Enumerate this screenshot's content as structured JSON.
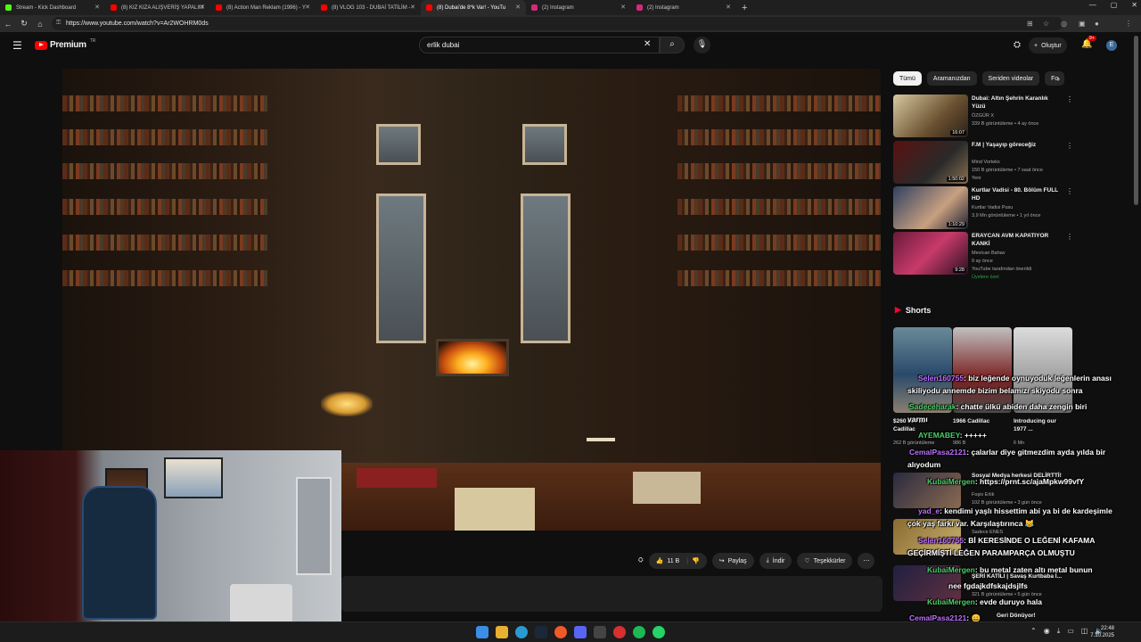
{
  "browser": {
    "tabs": [
      {
        "label": "Stream - Kick Dashboard",
        "color": "#53fc18"
      },
      {
        "label": "(8) KIZ KIZA ALIŞVERİŞ YAPALIM",
        "color": "#ff0000"
      },
      {
        "label": "(8) Action Man Reklam (1996) - Y",
        "color": "#ff0000"
      },
      {
        "label": "(8) VLOG 103 - DUBAİ TATİLİM -",
        "color": "#ff0000"
      },
      {
        "label": "(8) Dubai'de 8*k Var! - YouTu",
        "color": "#ff0000"
      },
      {
        "label": "(2) Instagram",
        "color": "#d62976"
      },
      {
        "label": "(2) Instagram",
        "color": "#d62976"
      }
    ],
    "url": "https://www.youtube.com/watch?v=Ar2WOHRM0ds"
  },
  "header": {
    "logo": "Premium",
    "logo_region": "TR",
    "search_value": "erlik dubai",
    "create_label": "Oluştur",
    "notif_count": "9+",
    "avatar_letter": "E"
  },
  "actions": {
    "like_count": "11 B",
    "share": "Paylaş",
    "download": "İndir",
    "thanks": "Teşekkürler"
  },
  "chips": [
    "Tümü",
    "Aramanızdan",
    "Seriden videolar",
    "Fo"
  ],
  "recommendations": [
    {
      "title": "Dubai: Altın Şehrin Karanlık Yüzü",
      "channel": "ÖZGÜR X",
      "meta": "339 B görüntüleme • 4 ay önce",
      "duration": "16:07",
      "badge": ""
    },
    {
      "title": "F.M | Yaşayıp göreceğiz",
      "channel": "Mind Vortekx",
      "meta": "150 B görüntüleme • 7 saat önce",
      "duration": "1:50:02",
      "badge": "Yeni"
    },
    {
      "title": "Kurtlar Vadisi - 80. Bölüm FULL HD",
      "channel": "Kurtlar Vadisi Pusu",
      "meta": "3,9 Mn görüntüleme • 1 yıl önce",
      "duration": "1:10:29",
      "badge": ""
    },
    {
      "title": "ERAYCAN AVM KAPATIYOR KANKİ",
      "channel": "Mevican Bahav",
      "meta": "9 ay önce",
      "duration": "9:28",
      "badge": "YouTube tarafından önerildi",
      "member": "Üyelere özel"
    }
  ],
  "shorts": {
    "header": "Shorts",
    "items": [
      {
        "title": "$260 000'lık Cadillac",
        "meta": "262 B görüntüleme"
      },
      {
        "title": "1966 Cadillac",
        "meta": "986 B"
      },
      {
        "title": "Introducing our 1977 ...",
        "meta": "6 Mn"
      }
    ]
  },
  "sidebar_fragments": [
    "Sosyal Medya herkesi DELİRTTİ!",
    "Foşix Erlik",
    "102 B görüntüleme • 3 gün önce",
    "Sadece ENES",
    "ŞERİ KATİLİ | Savaş Kurtbaba İ...",
    "321 B görüntüleme • 5 gün önce",
    "Geri Dönüyor!"
  ],
  "chat": [
    {
      "user": "Selen160755",
      "msg": ": biz leğende oynuyoduk leğenlerin anası",
      "ucolor": "#c070ff"
    },
    {
      "user": "",
      "msg": "skiliyodu annemde bizim belamızı skiyodu sonra",
      "ucolor": ""
    },
    {
      "user": "Sadeceharak",
      "msg": ": chatte ülkü abiden daha zengin biri",
      "ucolor": "#4dd06a"
    },
    {
      "user": "",
      "msg": "varmı",
      "ucolor": ""
    },
    {
      "user": "AYEMABEY",
      "msg": ": +++++",
      "ucolor": "#4dd06a"
    },
    {
      "user": "CemalPasa2121",
      "msg": ": çalarlar diye gitmezdim ayda yılda bir",
      "ucolor": "#c070ff"
    },
    {
      "user": "",
      "msg": "alıyodum",
      "ucolor": ""
    },
    {
      "user": "KubaiMergen",
      "msg": ": https://prnt.sc/ajaMpkw99vfY",
      "ucolor": "#4dd06a"
    },
    {
      "user": "yad_e",
      "msg": ": kendimi yaşlı hissettim abi ya bi de kardeşimle",
      "ucolor": "#c070ff"
    },
    {
      "user": "",
      "msg": "çok yaş farkı var. Karşılaştırınca 😹",
      "ucolor": ""
    },
    {
      "user": "Selen160755",
      "msg": ": Bİ KERESİNDE O LEĞENİ KAFAMA",
      "ucolor": "#c070ff"
    },
    {
      "user": "",
      "msg": "GEÇİRMİŞTİ LEĞEN PARAMPARÇA OLMUŞTU",
      "ucolor": ""
    },
    {
      "user": "KubaiMergen",
      "msg": ": bu metal zaten altı metal bunun",
      "ucolor": "#4dd06a"
    },
    {
      "user": "",
      "msg": "nee fgdajkdfskajdsjlfs",
      "ucolor": ""
    },
    {
      "user": "KubaiMergen",
      "msg": ": evde duruyo hala",
      "ucolor": "#4dd06a"
    },
    {
      "user": "CemalPasa2121",
      "msg": ": 😄",
      "ucolor": "#c070ff"
    },
    {
      "user": "KubaiMergen",
      "msg": ": 👺",
      "ucolor": "#4dd06a"
    }
  ],
  "taskbar": {
    "time": "22:48",
    "date": "7.10.2025"
  },
  "colors": {
    "accent": "#ff0000",
    "background": "#0f0f0f",
    "chat_purple": "#c070ff",
    "chat_green": "#4dd06a"
  }
}
